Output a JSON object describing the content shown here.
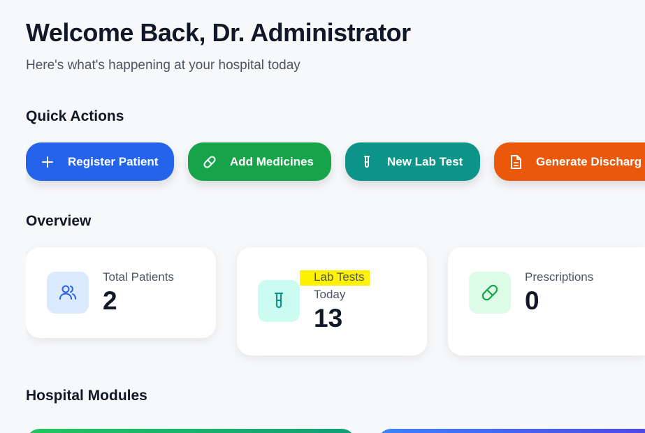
{
  "header": {
    "title": "Welcome Back, Dr. Administrator",
    "subtitle": "Here's what's happening at your hospital today"
  },
  "quick_actions": {
    "title": "Quick Actions",
    "buttons": [
      {
        "label": "Register Patient",
        "icon": "plus-icon",
        "color": "#2563eb"
      },
      {
        "label": "Add Medicines",
        "icon": "pill-icon",
        "color": "#16a34a"
      },
      {
        "label": "New Lab Test",
        "icon": "test-tube-icon",
        "color": "#0d9488"
      },
      {
        "label": "Generate Discharg",
        "icon": "document-icon",
        "color": "#ea580c"
      }
    ]
  },
  "overview": {
    "title": "Overview",
    "cards": [
      {
        "label": "Total Patients",
        "value": "2",
        "icon": "users-icon"
      },
      {
        "label_line1": "Lab Tests",
        "label_line2": "Today",
        "value": "13",
        "icon": "test-tube-icon"
      },
      {
        "label": "Prescriptions",
        "value": "0",
        "icon": "pill-icon"
      }
    ]
  },
  "modules": {
    "title": "Hospital Modules"
  },
  "colors": {
    "highlight": "#fef200"
  }
}
